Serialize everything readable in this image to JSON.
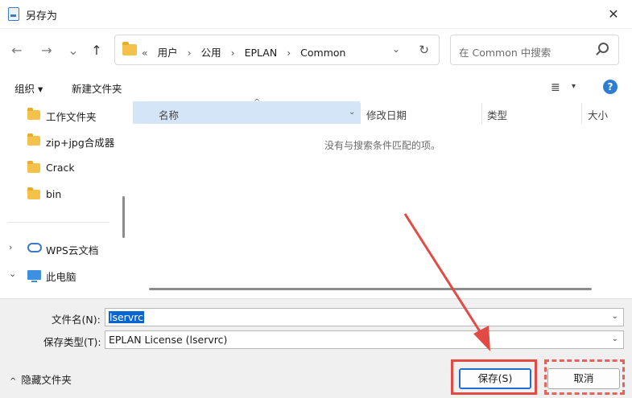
{
  "window": {
    "title": "另存为",
    "close_glyph": "✕"
  },
  "nav": {
    "back": "←",
    "forward": "→",
    "recent": "⌄",
    "up": "↑"
  },
  "address": {
    "overflow": "«",
    "crumbs": [
      "用户",
      "公用",
      "EPLAN",
      "Common"
    ],
    "separator": "›",
    "dropdown": "⌄",
    "refresh": "↻"
  },
  "search": {
    "placeholder": "在 Common 中搜索"
  },
  "toolbar": {
    "organize": "组织 ▾",
    "new_folder": "新建文件夹",
    "view_icon": "≣",
    "view_dd": "▾",
    "help": "?"
  },
  "sidebar": {
    "items": [
      {
        "label": "工作文件夹"
      },
      {
        "label": "zip+jpg合成器"
      },
      {
        "label": "Crack"
      },
      {
        "label": "bin"
      },
      {
        "label": "WPS云文档",
        "chevron": "›"
      },
      {
        "label": "此电脑",
        "chevron": "⌄"
      }
    ]
  },
  "columns": {
    "name": "名称",
    "modified": "修改日期",
    "type": "类型",
    "size": "大小",
    "sort": "^",
    "name_dd": "⌄"
  },
  "file_list": {
    "empty_message": "没有与搜索条件匹配的项。"
  },
  "form": {
    "filename_label": "文件名(N):",
    "filename_value": "lservrc",
    "filetype_label": "保存类型(T):",
    "filetype_value": "EPLAN License (lservrc)",
    "dd": "⌄"
  },
  "footer": {
    "hide_folders": "隐藏文件夹",
    "hide_caret": "^",
    "save": "保存(S)",
    "cancel": "取消"
  },
  "colors": {
    "accent": "#0a64d2",
    "highlight": "#e24b44",
    "folder": "#f4c14a"
  }
}
